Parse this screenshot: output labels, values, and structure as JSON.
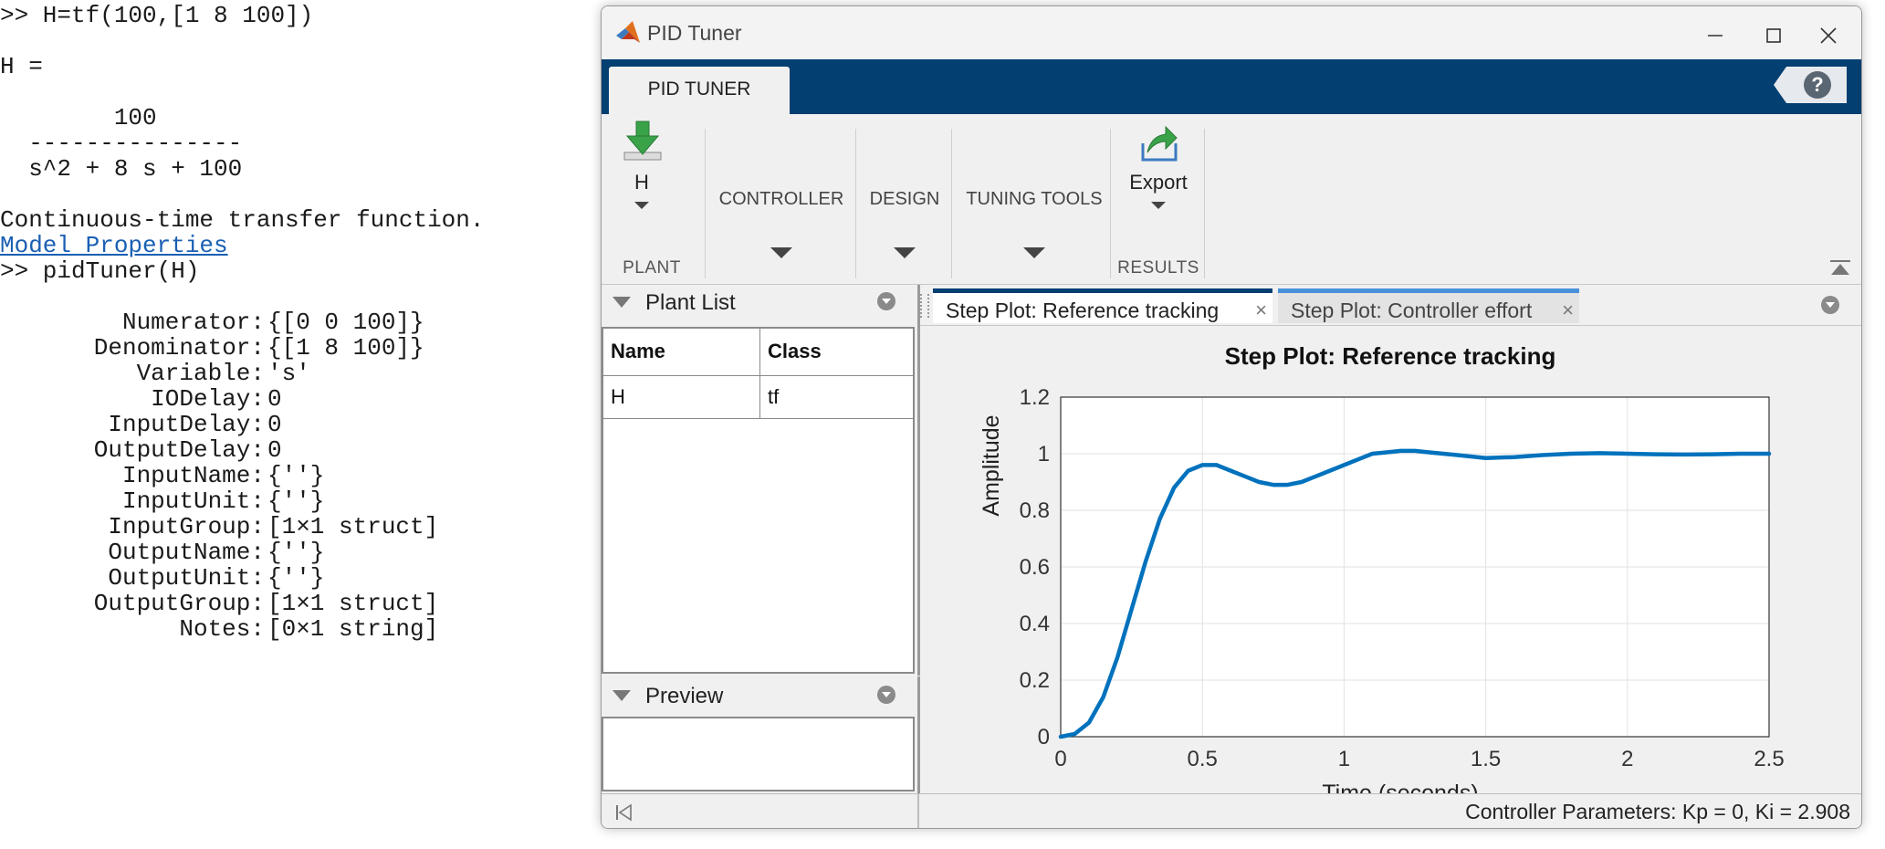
{
  "command_window": {
    "lines": [
      ">> H=tf(100,[1 8 100])",
      "H =",
      "        100",
      "  ---------------",
      "  s^2 + 8 s + 100",
      "Continuous-time transfer function.",
      ">> pidTuner(H)"
    ],
    "link": "Model Properties",
    "properties": [
      {
        "name": "Numerator:",
        "value": "{[0 0 100]}"
      },
      {
        "name": "Denominator:",
        "value": "{[1 8 100]}"
      },
      {
        "name": "Variable:",
        "value": "'s'"
      },
      {
        "name": "IODelay:",
        "value": "0"
      },
      {
        "name": "InputDelay:",
        "value": "0"
      },
      {
        "name": "OutputDelay:",
        "value": "0"
      },
      {
        "name": "InputName:",
        "value": "{''}"
      },
      {
        "name": "InputUnit:",
        "value": "{''}"
      },
      {
        "name": "InputGroup:",
        "value": "[1×1 struct]"
      },
      {
        "name": "OutputName:",
        "value": "{''}"
      },
      {
        "name": "OutputUnit:",
        "value": "{''}"
      },
      {
        "name": "OutputGroup:",
        "value": "[1×1 struct]"
      },
      {
        "name": "Notes:",
        "value": "[0×1 string]"
      }
    ]
  },
  "app": {
    "title": "PID Tuner",
    "ribbon_tab": "PID TUNER",
    "help_icon_glyph": "?",
    "plant_button": "H",
    "plant_group": "PLANT",
    "controller_label": "CONTROLLER",
    "design_label": "DESIGN",
    "tuning_tools_label": "TUNING TOOLS",
    "export_button": "Export",
    "results_group": "RESULTS"
  },
  "plant_list": {
    "title": "Plant List",
    "columns": [
      "Name",
      "Class"
    ],
    "rows": [
      [
        "H",
        "tf"
      ]
    ]
  },
  "preview": {
    "title": "Preview"
  },
  "doc_tabs": [
    {
      "label": "Step Plot: Reference tracking",
      "active": true
    },
    {
      "label": "Step Plot: Controller effort",
      "active": false
    }
  ],
  "close_glyph": "×",
  "status": "Controller Parameters: Kp =  0, Ki = 2.908",
  "chart_data": {
    "type": "line",
    "title": "Step Plot: Reference tracking",
    "xlabel": "Time (seconds)",
    "ylabel": "Amplitude",
    "xlim": [
      0,
      2.5
    ],
    "ylim": [
      0,
      1.2
    ],
    "xticks": [
      "0",
      "0.5",
      "1",
      "1.5",
      "2",
      "2.5"
    ],
    "yticks": [
      "0",
      "0.2",
      "0.4",
      "0.6",
      "0.8",
      "1",
      "1.2"
    ],
    "grid": true,
    "series": [
      {
        "color": "#0072bd",
        "x": [
          0,
          0.05,
          0.1,
          0.15,
          0.2,
          0.25,
          0.3,
          0.35,
          0.4,
          0.45,
          0.5,
          0.55,
          0.6,
          0.65,
          0.7,
          0.75,
          0.8,
          0.85,
          0.9,
          0.95,
          1.0,
          1.05,
          1.1,
          1.15,
          1.2,
          1.25,
          1.3,
          1.35,
          1.4,
          1.5,
          1.6,
          1.7,
          1.8,
          1.9,
          2.0,
          2.1,
          2.2,
          2.3,
          2.4,
          2.5
        ],
        "y": [
          0,
          0.01,
          0.05,
          0.14,
          0.28,
          0.45,
          0.62,
          0.77,
          0.88,
          0.94,
          0.96,
          0.96,
          0.94,
          0.92,
          0.9,
          0.89,
          0.89,
          0.9,
          0.92,
          0.94,
          0.96,
          0.98,
          1.0,
          1.005,
          1.01,
          1.01,
          1.005,
          1.0,
          0.995,
          0.985,
          0.988,
          0.995,
          1.0,
          1.002,
          1.0,
          0.998,
          0.997,
          0.998,
          1.0,
          1.0
        ]
      }
    ]
  }
}
